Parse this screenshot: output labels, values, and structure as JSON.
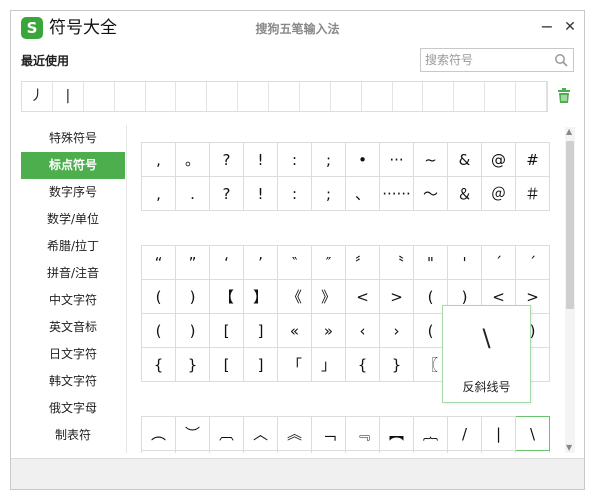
{
  "window": {
    "title": "符号大全",
    "logo": "S",
    "ime_name": "搜狗五笔输入法",
    "minimize": "−",
    "close": "✕"
  },
  "recent": {
    "title": "最近使用",
    "items": [
      "丿",
      "|",
      "",
      "",
      "",
      "",
      "",
      "",
      "",
      "",
      "",
      "",
      "",
      "",
      "",
      "",
      ""
    ]
  },
  "search": {
    "placeholder": "搜索符号"
  },
  "categories": [
    {
      "label": "特殊符号",
      "active": false
    },
    {
      "label": "标点符号",
      "active": true
    },
    {
      "label": "数字序号",
      "active": false
    },
    {
      "label": "数学/单位",
      "active": false
    },
    {
      "label": "希腊/拉丁",
      "active": false
    },
    {
      "label": "拼音/注音",
      "active": false
    },
    {
      "label": "中文字符",
      "active": false
    },
    {
      "label": "英文音标",
      "active": false
    },
    {
      "label": "日文字符",
      "active": false
    },
    {
      "label": "韩文字符",
      "active": false
    },
    {
      "label": "俄文字母",
      "active": false
    },
    {
      "label": "制表符",
      "active": false
    }
  ],
  "symbol_groups": [
    [
      [
        ",",
        "。",
        "?",
        "!",
        ":",
        ";",
        "•",
        "···",
        "~",
        "&",
        "@",
        "#"
      ],
      [
        ",",
        ".",
        "?",
        "!",
        ":",
        ";",
        "、",
        "······",
        "～",
        "＆",
        "＠",
        "＃"
      ]
    ],
    [
      [
        "“",
        "”",
        "‘",
        "’",
        "‶",
        "″",
        "〞",
        "〝",
        "\"",
        "'",
        "´",
        "ˊ"
      ],
      [
        "(",
        ")",
        "【",
        "】",
        "《",
        "》",
        "<",
        ">",
        "(",
        ")",
        "<",
        ">"
      ],
      [
        "(",
        ")",
        "[",
        "]",
        "«",
        "»",
        "‹",
        "›",
        "(",
        ")",
        "(",
        ")"
      ],
      [
        "{",
        "}",
        "[",
        "]",
        "「",
        "」",
        "{",
        "}",
        "〖",
        "〗",
        "",
        ""
      ]
    ],
    [
      [
        "︵",
        "︶",
        "︹",
        "︿",
        "︽",
        "﹁",
        "﹃",
        "︻",
        "︷",
        "/",
        "|",
        "\\"
      ],
      [
        "︶",
        "︸",
        "︺",
        "﹀",
        "︾",
        "﹂",
        "﹄",
        "︼",
        "︸",
        "",
        "",
        ""
      ]
    ]
  ],
  "tooltip": {
    "symbol": "\\",
    "name": "反斜线号"
  },
  "icons": {
    "logo": "sogou-logo-icon",
    "search": "search-icon",
    "trash": "trash-icon"
  },
  "colors": {
    "accent": "#4cae4c"
  }
}
